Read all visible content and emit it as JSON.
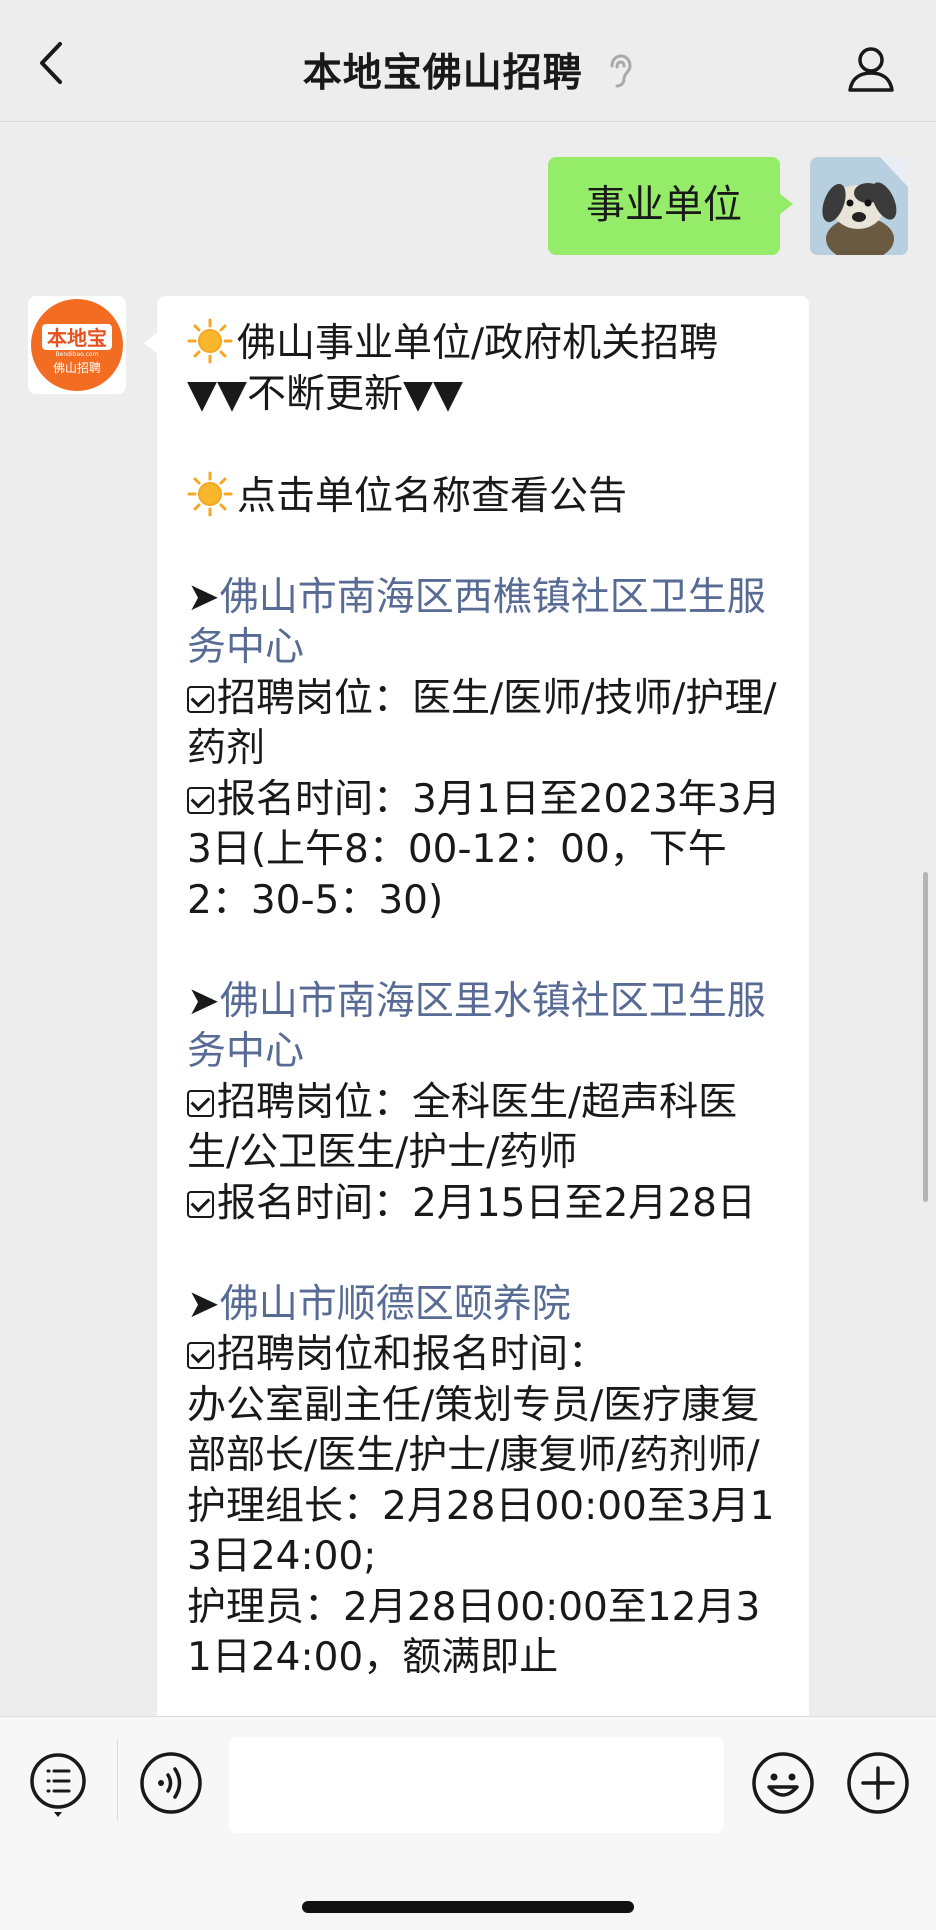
{
  "header": {
    "title": "本地宝佛山招聘"
  },
  "my_message": {
    "text": "事业单位"
  },
  "bot": {
    "avatar_brand": "本地宝",
    "avatar_sub": "Bendibao.com",
    "avatar_caption": "佛山招聘"
  },
  "reply": {
    "intro_line1": "佛山事业单位/政府机关招聘",
    "intro_line2": "▼▼不断更新▼▼",
    "intro_line3": "点击单位名称查看公告",
    "arrow": "➤",
    "entries": [
      {
        "name": "佛山市南海区西樵镇社区卫生服务中心",
        "posts": "招聘岗位：医生/医师/技师/护理/药剂",
        "time": "报名时间：3月1日至2023年3月3日(上午8：00-12：00，下午2：30-5：30)"
      },
      {
        "name": "佛山市南海区里水镇社区卫生服务中心",
        "posts": "招聘岗位：全科医生/超声科医生/公卫医生/护士/药师",
        "time": "报名时间：2月15日至2月28日"
      },
      {
        "name": "佛山市顺德区颐养院",
        "posts": "招聘岗位和报名时间：",
        "detail1": "办公室副主任/策划专员/医疗康复部部长/医生/护士/康复师/药剂师/护理组长：2月28日00:00至3月13日24:00;",
        "detail2": "护理员：2月28日00:00至12月31日24:00，额满即止"
      }
    ]
  },
  "input": {
    "placeholder": ""
  },
  "colors": {
    "my_bubble": "#95ec69",
    "link": "#576b95",
    "background": "#ededed",
    "brand_orange": "#f26c22"
  },
  "icons": [
    "back-arrow-icon",
    "ear-icon",
    "profile-icon",
    "sun-icon",
    "checkbox-icon",
    "menu-list-icon",
    "voice-icon",
    "emoji-icon",
    "plus-icon"
  ]
}
